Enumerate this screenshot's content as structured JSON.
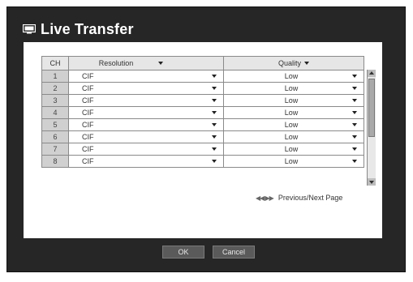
{
  "dialog": {
    "title": "Live Transfer",
    "icon": "monitor-icon"
  },
  "table": {
    "headers": {
      "ch": "CH",
      "resolution": "Resolution",
      "quality": "Quality"
    },
    "rows": [
      {
        "ch": "1",
        "resolution": "CIF",
        "quality": "Low"
      },
      {
        "ch": "2",
        "resolution": "CIF",
        "quality": "Low"
      },
      {
        "ch": "3",
        "resolution": "CIF",
        "quality": "Low"
      },
      {
        "ch": "4",
        "resolution": "CIF",
        "quality": "Low"
      },
      {
        "ch": "5",
        "resolution": "CIF",
        "quality": "Low"
      },
      {
        "ch": "6",
        "resolution": "CIF",
        "quality": "Low"
      },
      {
        "ch": "7",
        "resolution": "CIF",
        "quality": "Low"
      },
      {
        "ch": "8",
        "resolution": "CIF",
        "quality": "Low"
      }
    ]
  },
  "pager": {
    "label": "Previous/Next Page",
    "icon": "rewind-forward-icon"
  },
  "buttons": {
    "ok": "OK",
    "cancel": "Cancel"
  },
  "colors": {
    "window_bg": "#262626",
    "panel_bg": "#ffffff",
    "header_bg": "#e6e6e6",
    "ch_cell_bg": "#d0d0d0",
    "button_bg": "#5a5a5a"
  }
}
